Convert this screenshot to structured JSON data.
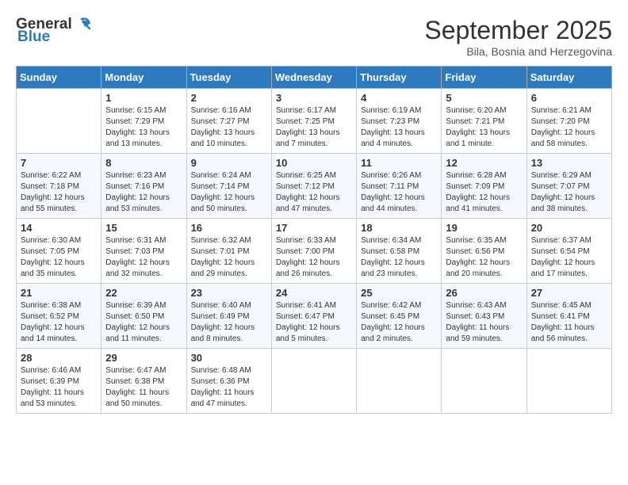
{
  "header": {
    "logo_general": "General",
    "logo_blue": "Blue",
    "month_title": "September 2025",
    "location": "Bila, Bosnia and Herzegovina"
  },
  "days_of_week": [
    "Sunday",
    "Monday",
    "Tuesday",
    "Wednesday",
    "Thursday",
    "Friday",
    "Saturday"
  ],
  "weeks": [
    [
      {
        "day": "",
        "info": ""
      },
      {
        "day": "1",
        "info": "Sunrise: 6:15 AM\nSunset: 7:29 PM\nDaylight: 13 hours\nand 13 minutes."
      },
      {
        "day": "2",
        "info": "Sunrise: 6:16 AM\nSunset: 7:27 PM\nDaylight: 13 hours\nand 10 minutes."
      },
      {
        "day": "3",
        "info": "Sunrise: 6:17 AM\nSunset: 7:25 PM\nDaylight: 13 hours\nand 7 minutes."
      },
      {
        "day": "4",
        "info": "Sunrise: 6:19 AM\nSunset: 7:23 PM\nDaylight: 13 hours\nand 4 minutes."
      },
      {
        "day": "5",
        "info": "Sunrise: 6:20 AM\nSunset: 7:21 PM\nDaylight: 13 hours\nand 1 minute."
      },
      {
        "day": "6",
        "info": "Sunrise: 6:21 AM\nSunset: 7:20 PM\nDaylight: 12 hours\nand 58 minutes."
      }
    ],
    [
      {
        "day": "7",
        "info": "Sunrise: 6:22 AM\nSunset: 7:18 PM\nDaylight: 12 hours\nand 55 minutes."
      },
      {
        "day": "8",
        "info": "Sunrise: 6:23 AM\nSunset: 7:16 PM\nDaylight: 12 hours\nand 53 minutes."
      },
      {
        "day": "9",
        "info": "Sunrise: 6:24 AM\nSunset: 7:14 PM\nDaylight: 12 hours\nand 50 minutes."
      },
      {
        "day": "10",
        "info": "Sunrise: 6:25 AM\nSunset: 7:12 PM\nDaylight: 12 hours\nand 47 minutes."
      },
      {
        "day": "11",
        "info": "Sunrise: 6:26 AM\nSunset: 7:11 PM\nDaylight: 12 hours\nand 44 minutes."
      },
      {
        "day": "12",
        "info": "Sunrise: 6:28 AM\nSunset: 7:09 PM\nDaylight: 12 hours\nand 41 minutes."
      },
      {
        "day": "13",
        "info": "Sunrise: 6:29 AM\nSunset: 7:07 PM\nDaylight: 12 hours\nand 38 minutes."
      }
    ],
    [
      {
        "day": "14",
        "info": "Sunrise: 6:30 AM\nSunset: 7:05 PM\nDaylight: 12 hours\nand 35 minutes."
      },
      {
        "day": "15",
        "info": "Sunrise: 6:31 AM\nSunset: 7:03 PM\nDaylight: 12 hours\nand 32 minutes."
      },
      {
        "day": "16",
        "info": "Sunrise: 6:32 AM\nSunset: 7:01 PM\nDaylight: 12 hours\nand 29 minutes."
      },
      {
        "day": "17",
        "info": "Sunrise: 6:33 AM\nSunset: 7:00 PM\nDaylight: 12 hours\nand 26 minutes."
      },
      {
        "day": "18",
        "info": "Sunrise: 6:34 AM\nSunset: 6:58 PM\nDaylight: 12 hours\nand 23 minutes."
      },
      {
        "day": "19",
        "info": "Sunrise: 6:35 AM\nSunset: 6:56 PM\nDaylight: 12 hours\nand 20 minutes."
      },
      {
        "day": "20",
        "info": "Sunrise: 6:37 AM\nSunset: 6:54 PM\nDaylight: 12 hours\nand 17 minutes."
      }
    ],
    [
      {
        "day": "21",
        "info": "Sunrise: 6:38 AM\nSunset: 6:52 PM\nDaylight: 12 hours\nand 14 minutes."
      },
      {
        "day": "22",
        "info": "Sunrise: 6:39 AM\nSunset: 6:50 PM\nDaylight: 12 hours\nand 11 minutes."
      },
      {
        "day": "23",
        "info": "Sunrise: 6:40 AM\nSunset: 6:49 PM\nDaylight: 12 hours\nand 8 minutes."
      },
      {
        "day": "24",
        "info": "Sunrise: 6:41 AM\nSunset: 6:47 PM\nDaylight: 12 hours\nand 5 minutes."
      },
      {
        "day": "25",
        "info": "Sunrise: 6:42 AM\nSunset: 6:45 PM\nDaylight: 12 hours\nand 2 minutes."
      },
      {
        "day": "26",
        "info": "Sunrise: 6:43 AM\nSunset: 6:43 PM\nDaylight: 11 hours\nand 59 minutes."
      },
      {
        "day": "27",
        "info": "Sunrise: 6:45 AM\nSunset: 6:41 PM\nDaylight: 11 hours\nand 56 minutes."
      }
    ],
    [
      {
        "day": "28",
        "info": "Sunrise: 6:46 AM\nSunset: 6:39 PM\nDaylight: 11 hours\nand 53 minutes."
      },
      {
        "day": "29",
        "info": "Sunrise: 6:47 AM\nSunset: 6:38 PM\nDaylight: 11 hours\nand 50 minutes."
      },
      {
        "day": "30",
        "info": "Sunrise: 6:48 AM\nSunset: 6:36 PM\nDaylight: 11 hours\nand 47 minutes."
      },
      {
        "day": "",
        "info": ""
      },
      {
        "day": "",
        "info": ""
      },
      {
        "day": "",
        "info": ""
      },
      {
        "day": "",
        "info": ""
      }
    ]
  ]
}
